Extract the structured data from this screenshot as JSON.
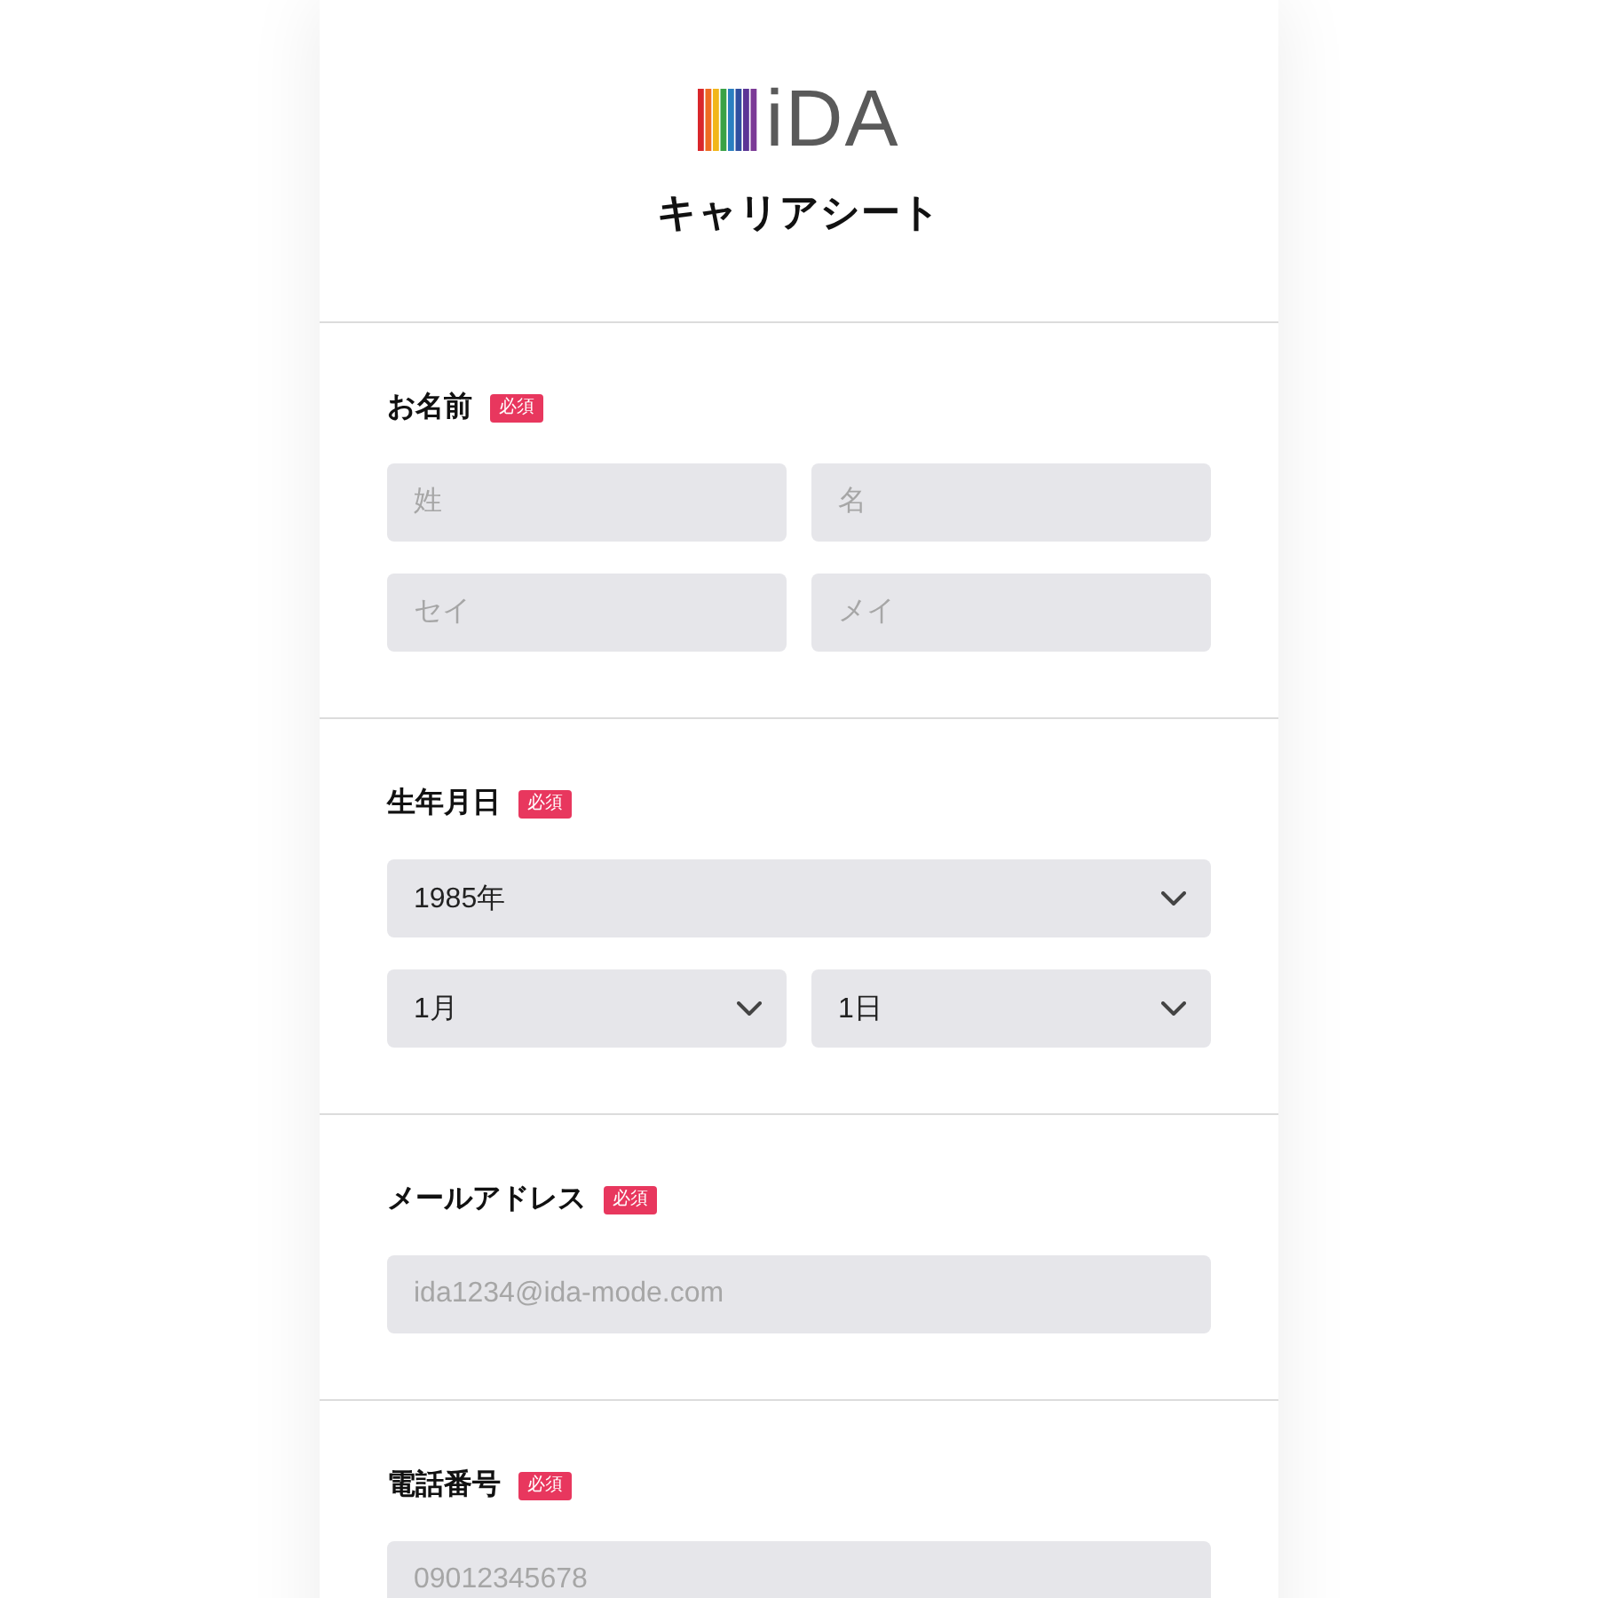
{
  "header": {
    "logo": {
      "text": "iDA"
    },
    "title": "キャリアシート"
  },
  "sections": [
    {
      "label": "お名前",
      "badge": "必須",
      "rows": [
        [
          {
            "kind": "input",
            "placeholder": "姓"
          },
          {
            "kind": "input",
            "placeholder": "名"
          }
        ],
        [
          {
            "kind": "input",
            "placeholder": "セイ"
          },
          {
            "kind": "input",
            "placeholder": "メイ"
          }
        ]
      ]
    },
    {
      "label": "生年月日",
      "badge": "必須",
      "rows": [
        [
          {
            "kind": "select",
            "value": "1985年"
          }
        ],
        [
          {
            "kind": "select",
            "value": "1月"
          },
          {
            "kind": "select",
            "value": "1日"
          }
        ]
      ]
    },
    {
      "label": "メールアドレス",
      "badge": "必須",
      "rows": [
        [
          {
            "kind": "input",
            "placeholder": "ida1234@ida-mode.com"
          }
        ]
      ]
    },
    {
      "label": "電話番号",
      "badge": "必須",
      "rows": [
        [
          {
            "kind": "input",
            "placeholder": "09012345678"
          }
        ]
      ]
    }
  ]
}
